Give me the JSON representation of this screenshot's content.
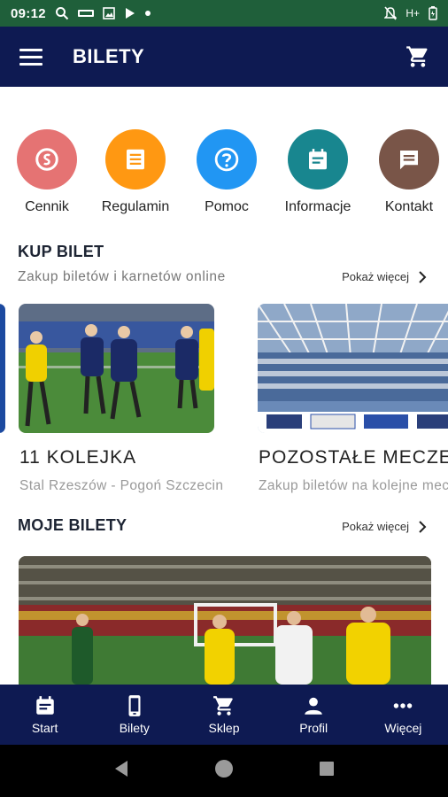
{
  "status_bar": {
    "time": "09:12",
    "network": "H+"
  },
  "app_bar": {
    "title": "BILETY"
  },
  "quick_actions": [
    {
      "label": "Cennik",
      "color": "#e57373",
      "icon": "price-icon"
    },
    {
      "label": "Regulamin",
      "color": "#ff9812",
      "icon": "document-icon"
    },
    {
      "label": "Pomoc",
      "color": "#2196f3",
      "icon": "help-icon"
    },
    {
      "label": "Informacje",
      "color": "#18868f",
      "icon": "calendar-icon"
    },
    {
      "label": "Kontakt",
      "color": "#795548",
      "icon": "chat-icon"
    }
  ],
  "kup_bilet": {
    "title": "KUP BILET",
    "subtitle": "Zakup biletów i karnetów online",
    "more_label": "Pokaż więcej",
    "cards": [
      {
        "title": "11 KOLEJKA",
        "subtitle": "Stal Rzeszów - Pogoń Szczecin"
      },
      {
        "title": "POZOSTAŁE MECZE",
        "subtitle": "Zakup biletów na kolejne mecze"
      }
    ]
  },
  "moje_bilety": {
    "title": "MOJE BILETY",
    "more_label": "Pokaż więcej"
  },
  "bottom_nav": [
    {
      "label": "Start",
      "icon": "calendar-icon"
    },
    {
      "label": "Bilety",
      "icon": "phone-icon"
    },
    {
      "label": "Sklep",
      "icon": "cart-icon"
    },
    {
      "label": "Profil",
      "icon": "person-icon"
    },
    {
      "label": "Więcej",
      "icon": "more-dots-icon"
    }
  ],
  "colors": {
    "app_bar": "#0e1a52",
    "status_bar": "#1f5f3a"
  }
}
